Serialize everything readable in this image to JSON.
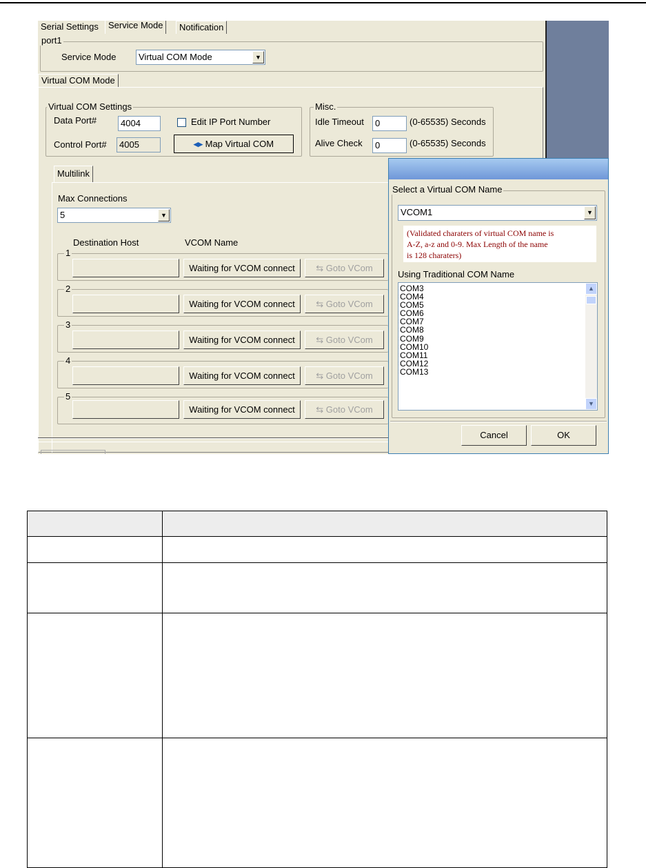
{
  "tabs": {
    "serial_settings": "Serial Settings",
    "service_mode": "Service Mode",
    "notification": "Notification"
  },
  "port_group": {
    "label": "port1",
    "service_mode_label": "Service Mode",
    "service_mode_value": "Virtual COM Mode"
  },
  "virtual_com_tab": "Virtual COM Mode",
  "vcom_settings": {
    "label": "Virtual COM Settings",
    "data_port_label": "Data Port#",
    "data_port_value": "4004",
    "control_port_label": "Control Port#",
    "control_port_value": "4005",
    "edit_ip_port_label": "Edit IP Port Number",
    "map_button": "Map Virtual COM"
  },
  "misc": {
    "label": "Misc.",
    "idle_timeout_label": "Idle Timeout",
    "idle_timeout_value": "0",
    "idle_timeout_range": "(0-65535) Seconds",
    "alive_check_label": "Alive Check",
    "alive_check_value": "0",
    "alive_check_range": "(0-65535) Seconds"
  },
  "multilink": {
    "tab": "Multilink",
    "max_connections_label": "Max Connections",
    "max_connections_value": "5",
    "col_destination": "Destination Host",
    "col_vcom": "VCOM Name",
    "rows": [
      {
        "num": "1",
        "vcom": "Waiting for VCOM connect",
        "goto": "Goto VCom"
      },
      {
        "num": "2",
        "vcom": "Waiting for VCOM connect",
        "goto": "Goto VCom"
      },
      {
        "num": "3",
        "vcom": "Waiting for VCOM connect",
        "goto": "Goto VCom"
      },
      {
        "num": "4",
        "vcom": "Waiting for VCOM connect",
        "goto": "Goto VCom"
      },
      {
        "num": "5",
        "vcom": "Waiting for VCOM connect",
        "goto": "Goto VCom"
      }
    ]
  },
  "dialog": {
    "select_label": "Select a Virtual COM Name",
    "select_value": "VCOM1",
    "note": "(Validated charaters of virtual COM name is\nA-Z, a-z and 0-9. Max Length of the name\nis 128 charaters)",
    "traditional_label": "Using Traditional COM Name",
    "com_list": [
      "COM3",
      "COM4",
      "COM5",
      "COM6",
      "COM7",
      "COM8",
      "COM9",
      "COM10",
      "COM11",
      "COM12",
      "COM13"
    ],
    "cancel": "Cancel",
    "ok": "OK"
  },
  "colors": {
    "dialog_titlebar": "#6f97d8",
    "window_bg": "#ece9d8",
    "note_text": "#8b0000"
  }
}
